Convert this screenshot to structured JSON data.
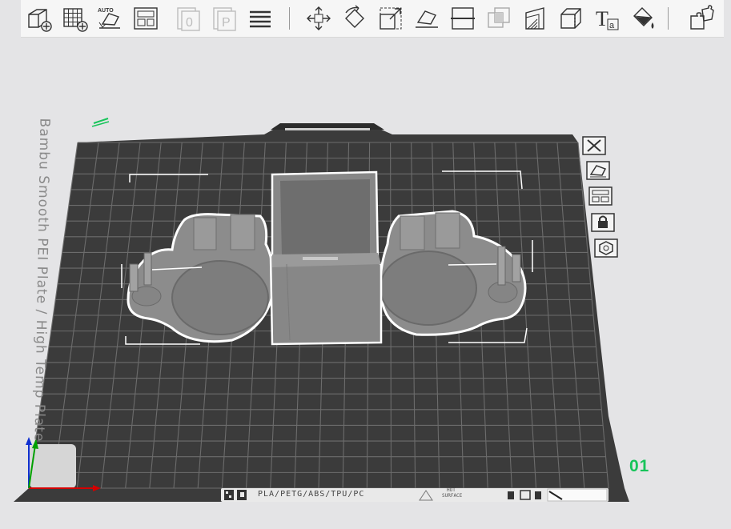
{
  "toolbar": {
    "items": [
      {
        "name": "add-object-icon",
        "tooltip": "Add"
      },
      {
        "name": "add-plate-icon",
        "tooltip": "Add plate"
      },
      {
        "name": "auto-orient-icon",
        "tooltip": "Auto orient",
        "badge": "AUTO"
      },
      {
        "name": "arrange-icon",
        "tooltip": "Arrange"
      },
      {
        "name": "split-objects-icon",
        "tooltip": "Split to objects",
        "glyph": "0"
      },
      {
        "name": "split-parts-icon",
        "tooltip": "Split to parts",
        "glyph": "P"
      },
      {
        "name": "layers-icon",
        "tooltip": "Variable layer height"
      },
      {
        "name": "move-icon",
        "tooltip": "Move"
      },
      {
        "name": "rotate-icon",
        "tooltip": "Rotate"
      },
      {
        "name": "scale-icon",
        "tooltip": "Scale"
      },
      {
        "name": "lay-on-face-icon",
        "tooltip": "Lay on face"
      },
      {
        "name": "cut-icon",
        "tooltip": "Cut"
      },
      {
        "name": "boolean-icon",
        "tooltip": "Mesh boolean"
      },
      {
        "name": "support-paint-icon",
        "tooltip": "Support painting"
      },
      {
        "name": "seam-paint-icon",
        "tooltip": "Seam painting"
      },
      {
        "name": "text-icon",
        "tooltip": "Text shape",
        "glyph": "T",
        "sub": "a"
      },
      {
        "name": "color-paint-icon",
        "tooltip": "Color painting"
      },
      {
        "name": "assembly-icon",
        "tooltip": "Assembly view"
      }
    ]
  },
  "plate": {
    "label": "Bambu Smooth PEI Plate / High Temp Plate",
    "index": "01",
    "materials": "PLA/PETG/ABS/TPU/PC",
    "surface_line1": "HOT",
    "surface_line2": "SURFACE"
  },
  "plate_toolbar": [
    {
      "name": "close-icon"
    },
    {
      "name": "orient-plate-icon"
    },
    {
      "name": "arrange-plate-icon"
    },
    {
      "name": "lock-icon"
    },
    {
      "name": "settings-icon"
    }
  ],
  "colors": {
    "bed": "#3b3b3b",
    "grid": "#6a6a6a",
    "model": "#8a8a8a",
    "selection": "#ffffff",
    "plate_index": "#17c45a",
    "axis_x": "#d40000",
    "axis_y": "#00a000",
    "axis_z": "#1030d0"
  }
}
